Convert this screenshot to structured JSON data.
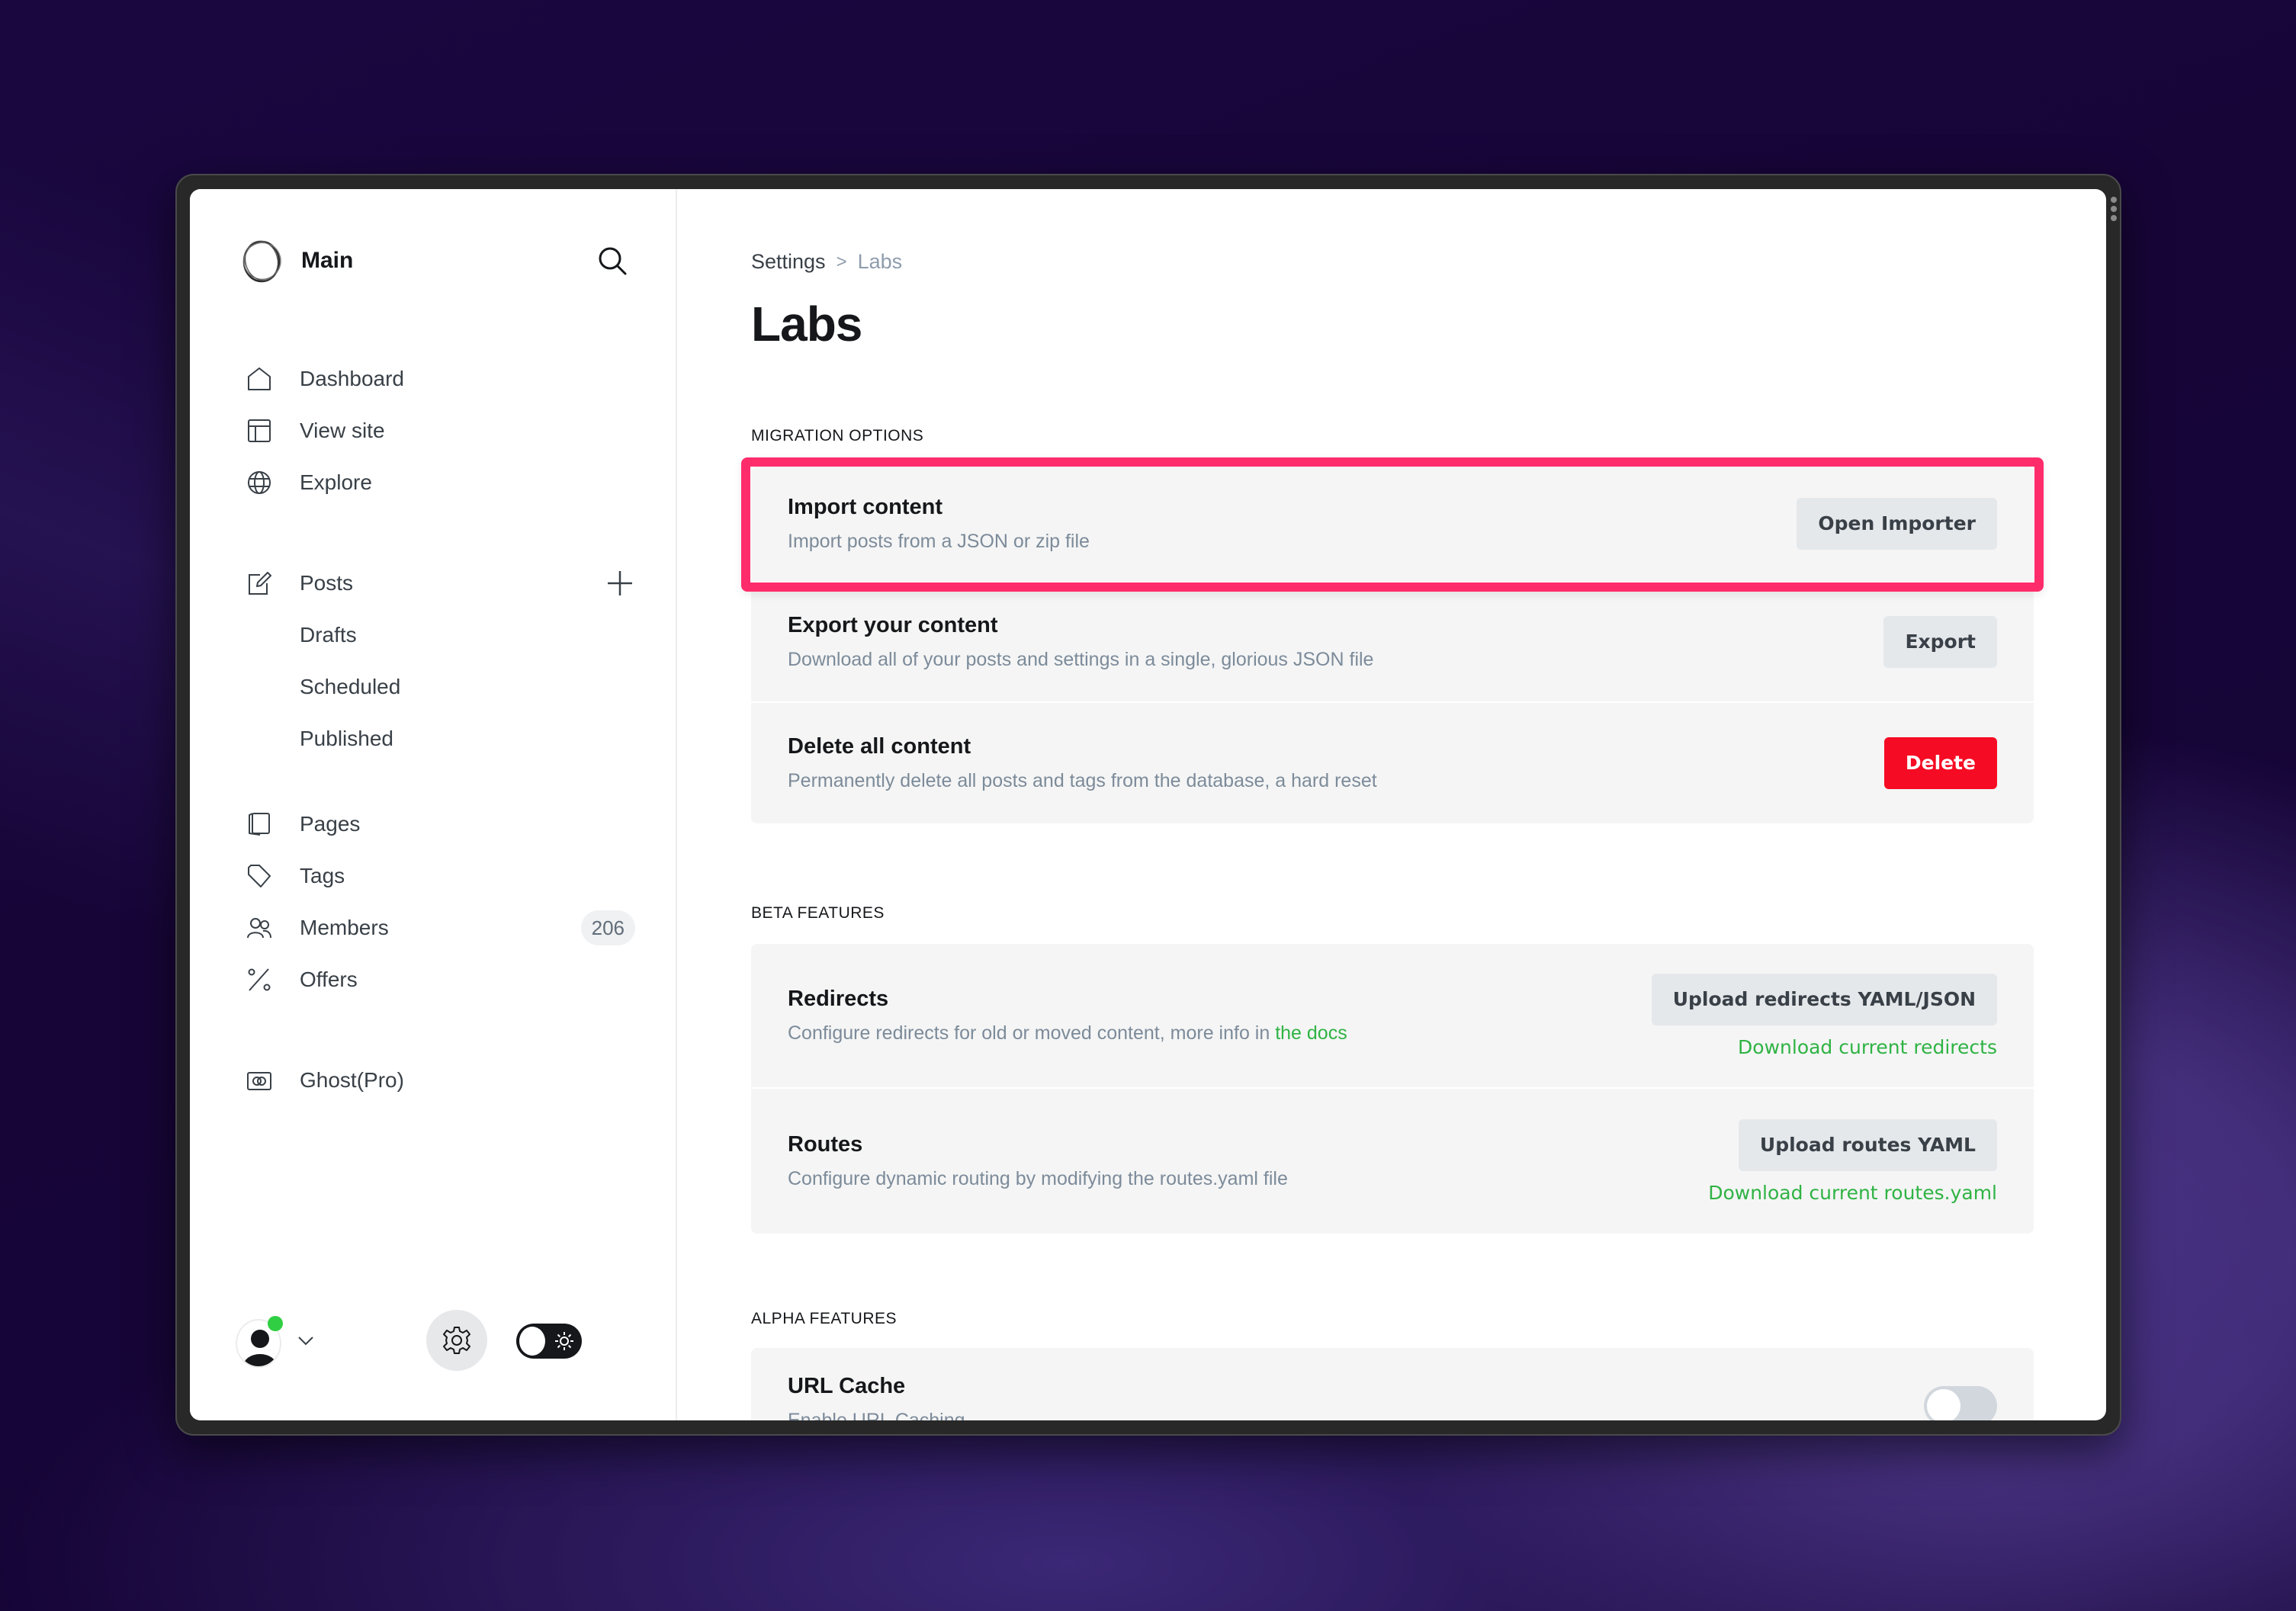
{
  "sidebar": {
    "brand_name": "Main",
    "nav": [
      {
        "label": "Dashboard",
        "icon": "home-icon"
      },
      {
        "label": "View site",
        "icon": "layout-icon"
      },
      {
        "label": "Explore",
        "icon": "globe-icon"
      }
    ],
    "posts": {
      "label": "Posts",
      "icon": "edit-icon"
    },
    "posts_sub": [
      {
        "label": "Drafts"
      },
      {
        "label": "Scheduled"
      },
      {
        "label": "Published"
      }
    ],
    "content_nav": [
      {
        "label": "Pages",
        "icon": "pages-icon"
      },
      {
        "label": "Tags",
        "icon": "tag-icon"
      },
      {
        "label": "Members",
        "icon": "members-icon",
        "count": "206"
      },
      {
        "label": "Offers",
        "icon": "percent-icon"
      }
    ],
    "ghost_pro": {
      "label": "Ghost(Pro)",
      "icon": "ghost-pro-icon"
    },
    "footer": {
      "online_color": "#30cf43"
    }
  },
  "main": {
    "breadcrumb": {
      "parent": "Settings",
      "separator": ">",
      "current": "Labs"
    },
    "title": "Labs",
    "sections": [
      {
        "label": "MIGRATION OPTIONS",
        "rows": [
          {
            "title": "Import content",
            "desc": "Import posts from a JSON or zip file",
            "button": "Open Importer",
            "highlighted": true
          },
          {
            "title": "Export your content",
            "desc": "Download all of your posts and settings in a single, glorious JSON file",
            "button": "Export"
          },
          {
            "title": "Delete all content",
            "desc": "Permanently delete all posts and tags from the database, a hard reset",
            "button": "Delete",
            "danger": true
          }
        ]
      },
      {
        "label": "BETA FEATURES",
        "rows": [
          {
            "title": "Redirects",
            "desc": "Configure redirects for old or moved content, more info in ",
            "desc_link": "the docs",
            "button": "Upload redirects YAML/JSON",
            "link": "Download current redirects"
          },
          {
            "title": "Routes",
            "desc": "Configure dynamic routing by modifying the routes.yaml file",
            "button": "Upload routes YAML",
            "link": "Download current routes.yaml"
          }
        ]
      },
      {
        "label": "ALPHA FEATURES",
        "rows": [
          {
            "title": "URL Cache",
            "desc": "Enable URL Caching",
            "toggle": false
          }
        ]
      }
    ]
  },
  "colors": {
    "highlight": "#ff2c6b",
    "danger": "#f50b23",
    "link_green": "#30cf43",
    "wallpaper": "#1a0740"
  }
}
